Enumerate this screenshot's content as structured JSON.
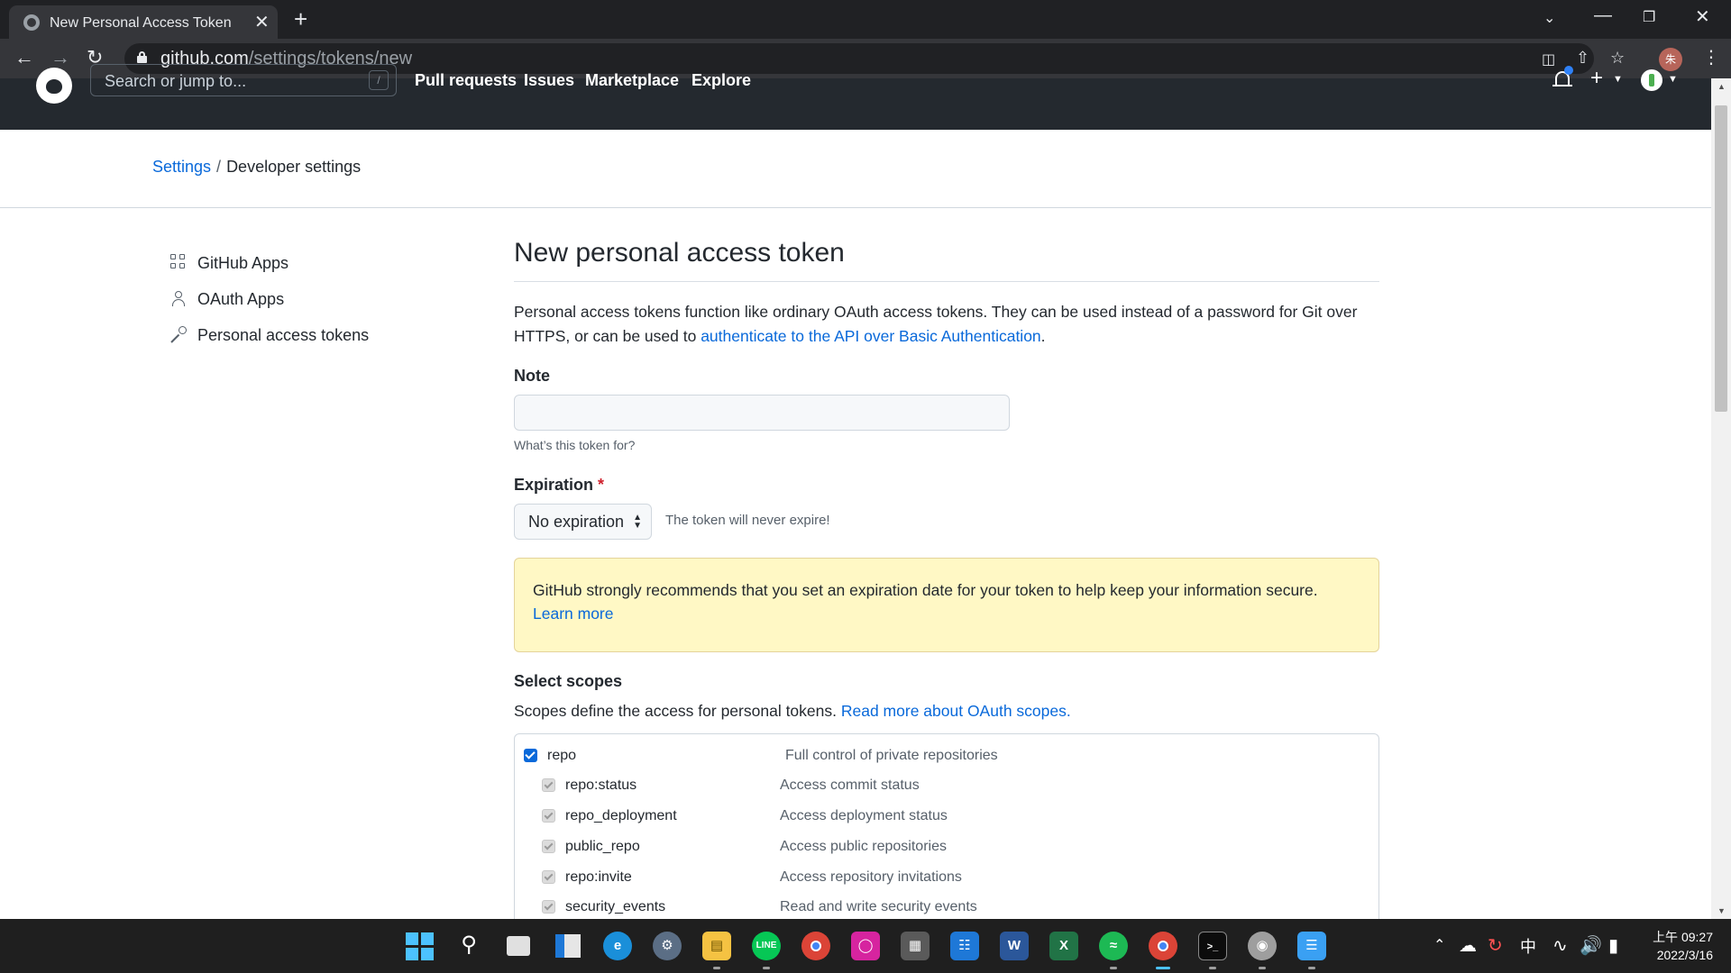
{
  "browser": {
    "tab_title": "New Personal Access Token",
    "tab_close": "✕",
    "new_tab": "+",
    "url_host": "github.com",
    "url_path": "/settings/tokens/new",
    "profile_initial": "朱"
  },
  "github": {
    "search_placeholder": "Search or jump to...",
    "search_shortcut": "/",
    "nav": [
      "Pull requests",
      "Issues",
      "Marketplace",
      "Explore"
    ]
  },
  "breadcrumb": {
    "parent": "Settings",
    "separator": "/",
    "current": "Developer settings"
  },
  "sidebar": {
    "items": [
      {
        "label": "GitHub Apps",
        "icon": "apps-icon"
      },
      {
        "label": "OAuth Apps",
        "icon": "person-icon"
      },
      {
        "label": "Personal access tokens",
        "icon": "key-icon"
      }
    ]
  },
  "main": {
    "title": "New personal access token",
    "intro_text": "Personal access tokens function like ordinary OAuth access tokens. They can be used instead of a password for Git over HTTPS, or can be used to ",
    "intro_link": "authenticate to the API over Basic Authentication",
    "intro_end": ".",
    "note_label": "Note",
    "note_value": "",
    "note_hint": "What’s this token for?",
    "expiration_label": "Expiration",
    "expiration_required": "*",
    "expiration_value": "No expiration",
    "expiration_note": "The token will never expire!",
    "flash_text": "GitHub strongly recommends that you set an expiration date for your token to help keep your information secure.",
    "flash_link": "Learn more",
    "scopes_title": "Select scopes",
    "scopes_desc": "Scopes define the access for personal tokens. ",
    "scopes_link": "Read more about OAuth scopes.",
    "scopes": [
      {
        "name": "repo",
        "desc": "Full control of private repositories",
        "checked": true,
        "parent": true
      },
      {
        "name": "repo:status",
        "desc": "Access commit status",
        "checked": true,
        "parent": false
      },
      {
        "name": "repo_deployment",
        "desc": "Access deployment status",
        "checked": true,
        "parent": false
      },
      {
        "name": "public_repo",
        "desc": "Access public repositories",
        "checked": true,
        "parent": false
      },
      {
        "name": "repo:invite",
        "desc": "Access repository invitations",
        "checked": true,
        "parent": false
      },
      {
        "name": "security_events",
        "desc": "Read and write security events",
        "checked": true,
        "parent": false
      }
    ]
  },
  "taskbar": {
    "apps": [
      "Start",
      "Search",
      "Task View",
      "Widgets",
      "Edge",
      "Settings",
      "File Explorer",
      "LINE",
      "Chrome",
      "Instagram",
      "Calculator",
      "Calendar",
      "Word",
      "Excel",
      "Spotify",
      "Chrome Profile",
      "Terminal",
      "App",
      "Notepad"
    ],
    "ime": "中",
    "time": "上午 09:27",
    "date": "2022/3/16"
  },
  "colors": {
    "link": "#0969da",
    "header_bg": "#24292f",
    "flash_bg": "#fff8c5",
    "required": "#cf222e",
    "taskbar_active": "#4cc2ff"
  }
}
